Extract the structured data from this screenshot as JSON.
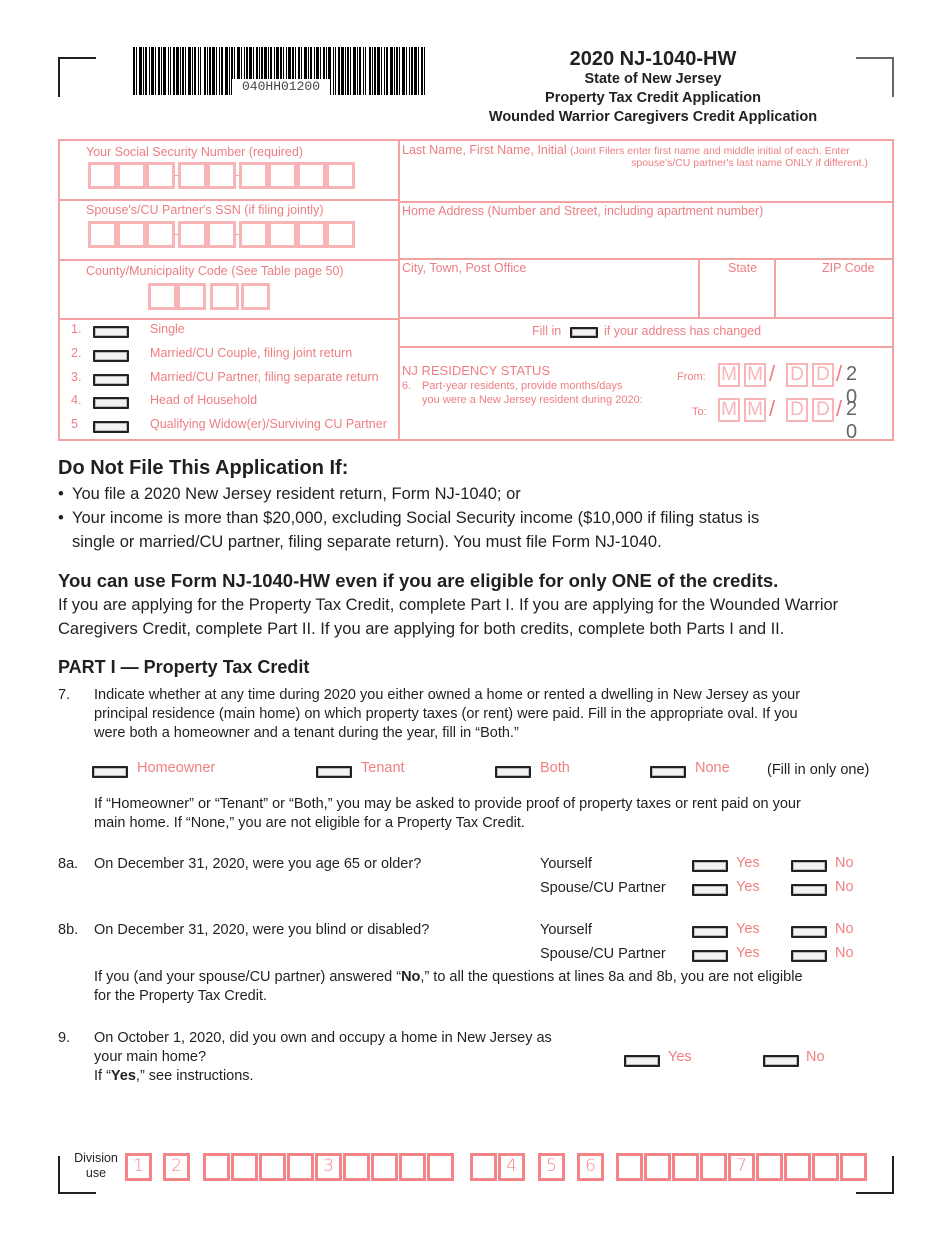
{
  "barcode": {
    "text": "040HH01200"
  },
  "header": {
    "form_title": "2020 NJ-1040-HW",
    "state": "State of New Jersey",
    "subtitle1": "Property Tax Credit Application",
    "subtitle2": "Wounded Warrior Caregivers Credit Application"
  },
  "identity": {
    "ssn_label": "Your Social Security Number (required)",
    "spouse_ssn_label": "Spouse's/CU Partner's SSN (if filing jointly)",
    "county_label": "County/Municipality Code (See Table page 50)",
    "name_label": "Last Name, First Name, Initial",
    "name_note": "(Joint Filers enter first name and middle initial of each. Enter",
    "name_note2": "spouse's/CU partner's last name ONLY if different.)",
    "address_label": "Home Address (Number and Street, including apartment number)",
    "city_label": "City, Town, Post Office",
    "state_label": "State",
    "zip_label": "ZIP Code",
    "ssn_value": "",
    "spouse_ssn_value": "",
    "county_value": "",
    "name_value": "",
    "address_value": "",
    "city_value": "",
    "state_value": "",
    "zip_value": ""
  },
  "filing_status": {
    "items": [
      {
        "num": "1.",
        "label": "Single"
      },
      {
        "num": "2.",
        "label": "Married/CU Couple, filing joint return"
      },
      {
        "num": "3.",
        "label": "Married/CU Partner, filing separate return"
      },
      {
        "num": "4.",
        "label": "Head of Household"
      },
      {
        "num": "5",
        "label": "Qualifying Widow(er)/Surviving CU Partner"
      }
    ]
  },
  "address_changed": {
    "prefix": "Fill in",
    "suffix": "if your address has changed"
  },
  "residency": {
    "title": "NJ RESIDENCY STATUS",
    "num": "6.",
    "line1": "Part-year residents, provide months/days",
    "line2": "you were a New Jersey resident during 2020:",
    "from_label": "From:",
    "to_label": "To:",
    "month_placeholder": "M",
    "day_placeholder": "D",
    "slash": "/",
    "year_prefix": "2 0"
  },
  "do_not_file": {
    "heading": "Do Not File This Application If:",
    "bullets": [
      "You file a 2020 New Jersey resident return, Form NJ-1040; or",
      "Your income is more than $20,000, excluding Social Security income ($10,000 if filing status is",
      "single or married/CU partner, filing separate return). You must file Form NJ-1040."
    ],
    "bullet_char": "•"
  },
  "eligibility": {
    "heading": "You can use Form NJ-1040-HW even if you are eligible for only ONE of the credits.",
    "line1": "If you are applying for the Property Tax Credit, complete Part I. If you are applying for the Wounded Warrior",
    "line2": "Caregivers Credit, complete Part II. If you are applying for both credits, complete both Parts I and II."
  },
  "part1": {
    "heading": "PART I — Property Tax Credit",
    "q7": {
      "num": "7.",
      "lines": [
        "Indicate whether at any time during 2020 you either owned a home or rented a dwelling in New Jersey as your",
        "principal residence (main home) on which property taxes (or rent) were paid. Fill in the appropriate oval. If you",
        "were both a homeowner and a tenant during the year, fill in “Both.”"
      ],
      "options": [
        "Homeowner",
        "Tenant",
        "Both",
        "None"
      ],
      "fill_note": "(Fill in only one)",
      "note_lines": [
        "If “Homeowner” or “Tenant” or “Both,” you may be asked to provide proof of property taxes or rent paid on your",
        "main home. If “None,” you are not eligible for a Property Tax Credit."
      ]
    },
    "q8a": {
      "num": "8a.",
      "text": "On December 31, 2020, were you age 65 or older?",
      "rows": [
        "Yourself",
        "Spouse/CU Partner"
      ],
      "yes": "Yes",
      "no": "No"
    },
    "q8b": {
      "num": "8b.",
      "text": "On December 31, 2020, were you blind or disabled?",
      "rows": [
        "Yourself",
        "Spouse/CU Partner"
      ],
      "yes": "Yes",
      "no": "No",
      "note_pre": "If you (and your spouse/CU partner) answered “",
      "note_bold": "No",
      "note_post": ",” to all the questions at lines 8a and 8b, you are not eligible",
      "note_line2": "for the Property Tax Credit."
    },
    "q9": {
      "num": "9.",
      "line1": "On October 1, 2020, did you own and occupy a home in New Jersey as",
      "line2": "your main home?",
      "line3_pre": "If “",
      "line3_bold": "Yes",
      "line3_post": ",” see instructions.",
      "yes": "Yes",
      "no": "No"
    }
  },
  "division_use": {
    "label1": "Division",
    "label2": "use",
    "markers": [
      "1",
      "2",
      "3",
      "4",
      "5",
      "6",
      "7"
    ]
  },
  "colors": {
    "form_pink": "#f4a1a4",
    "label_pink": "#ee7e83",
    "division_red": "#f48488",
    "text": "#231f20"
  }
}
